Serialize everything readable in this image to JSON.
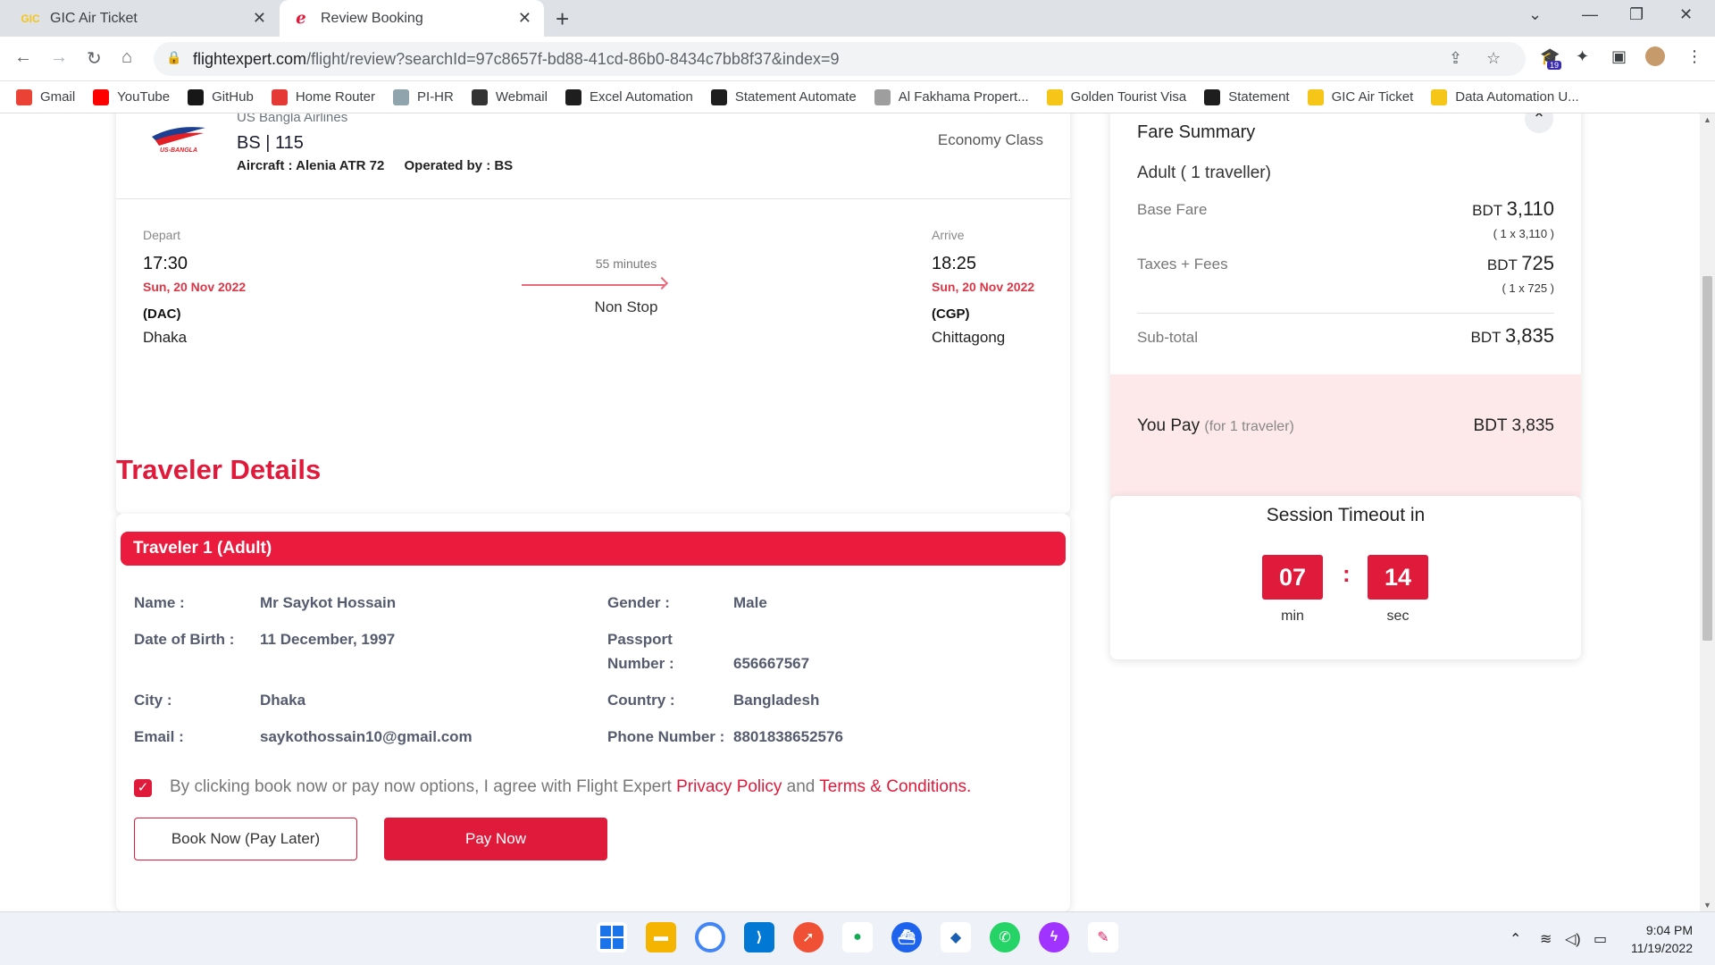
{
  "browser": {
    "tabs": [
      {
        "label": "GIC Air Ticket"
      },
      {
        "label": "Review Booking"
      }
    ],
    "url_domain": "flightexpert.com",
    "url_path": "/flight/review?searchId=97c8657f-bd88-41cd-86b0-8434c7bb8f37&index=9",
    "profile_badge": "19",
    "bookmarks": [
      {
        "label": "Gmail",
        "icon": "gmail-icon",
        "color": "#ea4335"
      },
      {
        "label": "YouTube",
        "icon": "youtube-icon",
        "color": "#ff0000"
      },
      {
        "label": "GitHub",
        "icon": "github-icon",
        "color": "#181717"
      },
      {
        "label": "Home Router",
        "icon": "router-icon",
        "color": "#e53935"
      },
      {
        "label": "PI-HR",
        "icon": "document-icon",
        "color": "#90a4ae"
      },
      {
        "label": "Webmail",
        "icon": "webmail-icon",
        "color": "#333333"
      },
      {
        "label": "Excel Automation",
        "icon": "react-icon",
        "color": "#1e1e1e"
      },
      {
        "label": "Statement Automate",
        "icon": "react-icon",
        "color": "#1e1e1e"
      },
      {
        "label": "Al Fakhama Propert...",
        "icon": "page-icon",
        "color": "#9e9e9e"
      },
      {
        "label": "Golden Tourist Visa",
        "icon": "gic-icon",
        "color": "#f5c518"
      },
      {
        "label": "Statement",
        "icon": "react-icon",
        "color": "#1e1e1e"
      },
      {
        "label": "GIC Air Ticket",
        "icon": "gic-icon",
        "color": "#f5c518"
      },
      {
        "label": "Data Automation U...",
        "icon": "gic-icon",
        "color": "#f5c518"
      }
    ]
  },
  "flight": {
    "airline": "US Bangla Airlines",
    "flight_number": "BS | 115",
    "aircraft_label": "Aircraft : Alenia ATR 72",
    "operated_label": "Operated by : BS",
    "cabin": "Economy Class",
    "depart": {
      "label": "Depart",
      "time": "17:30",
      "date": "Sun, 20 Nov 2022",
      "code": "(DAC)",
      "city": "Dhaka"
    },
    "arrive": {
      "label": "Arrive",
      "time": "18:25",
      "date": "Sun, 20 Nov 2022",
      "code": "(CGP)",
      "city": "Chittagong"
    },
    "duration": "55 minutes",
    "stops": "Non Stop"
  },
  "traveler_section": {
    "title": "Traveler Details",
    "header": "Traveler 1 (Adult)",
    "fields": {
      "name_label": "Name :",
      "name_value": "Mr Saykot Hossain",
      "dob_label": "Date of Birth :",
      "dob_value": "11 December, 1997",
      "city_label": "City :",
      "city_value": "Dhaka",
      "email_label": "Email :",
      "email_value": "saykothossain10@gmail.com",
      "gender_label": "Gender :",
      "gender_value": "Male",
      "passport_label_1": "Passport",
      "passport_label_2": "Number :",
      "passport_value": "656667567",
      "country_label": "Country :",
      "country_value": "Bangladesh",
      "phone_label": "Phone Number :",
      "phone_value": "8801838652576"
    },
    "agree_text_1": "By clicking book now or pay now options, I agree with Flight Expert ",
    "privacy_link": "Privacy Policy",
    "agree_and": " and ",
    "terms_link": "Terms & Conditions",
    "agree_end": ".",
    "agree_checked": true,
    "book_later_label": "Book Now (Pay Later)",
    "pay_now_label": "Pay Now"
  },
  "fare_summary": {
    "title": "Fare Summary",
    "passenger": "Adult ( 1 traveller)",
    "base_fare_label": "Base Fare",
    "base_fare_cur": "BDT ",
    "base_fare_amount": "3,110",
    "base_fare_breakdown": "( 1 x 3,110 )",
    "taxes_label": "Taxes + Fees",
    "taxes_cur": "BDT ",
    "taxes_amount": "725",
    "taxes_breakdown": "( 1 x 725 )",
    "subtotal_label": "Sub-total",
    "subtotal_cur": "BDT ",
    "subtotal_amount": "3,835",
    "you_pay_label": "You Pay ",
    "you_pay_note": "(for 1 traveler)",
    "you_pay_amount": "BDT 3,835"
  },
  "session": {
    "title": "Session Timeout in",
    "minutes": "07",
    "seconds": "14",
    "separator": ":",
    "min_label": "min",
    "sec_label": "sec"
  },
  "taskbar": {
    "time": "9:04 PM",
    "date": "11/19/2022"
  },
  "colors": {
    "accent": "#e01a3b",
    "header_red": "#ea1b3d",
    "pay_bg": "#fde8ea"
  }
}
